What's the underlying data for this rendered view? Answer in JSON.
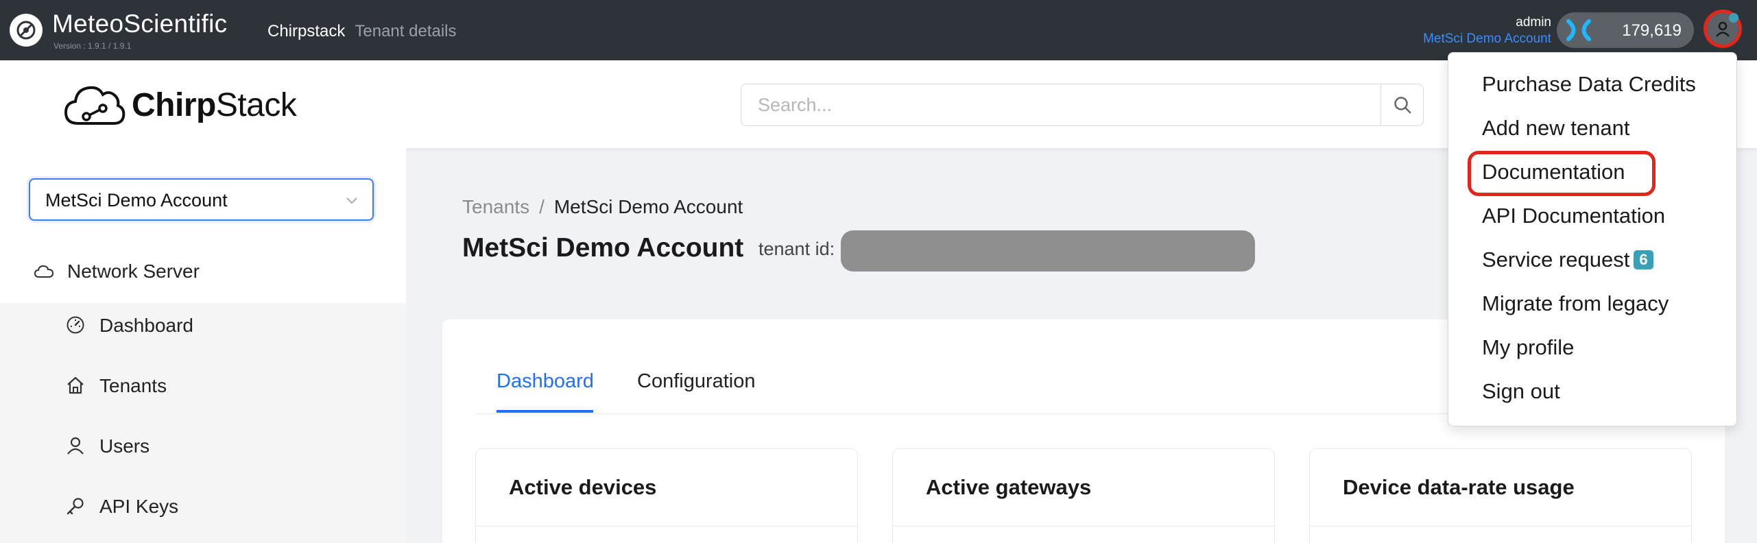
{
  "topbar": {
    "brand": "MeteoScientific",
    "version": "Version : 1.9.1 / 1.9.1",
    "crumbs": [
      "Chirpstack",
      "Tenant details"
    ],
    "user": "admin",
    "account": "MetSci Demo Account",
    "credits": "179,619"
  },
  "header": {
    "logo_text_bold": "Chirp",
    "logo_text_rest": "Stack",
    "search_placeholder": "Search..."
  },
  "sidebar": {
    "tenant": "MetSci Demo Account",
    "network_server": "Network Server",
    "items": [
      {
        "label": "Dashboard",
        "icon": "dashboard-icon"
      },
      {
        "label": "Tenants",
        "icon": "home-icon"
      },
      {
        "label": "Users",
        "icon": "user-icon"
      },
      {
        "label": "API Keys",
        "icon": "key-icon"
      }
    ]
  },
  "main": {
    "breadcrumb": [
      "Tenants",
      "/",
      "MetSci Demo Account"
    ],
    "title": "MetSci Demo Account",
    "tenant_id_label": "tenant id:",
    "tabs": [
      "Dashboard",
      "Configuration"
    ],
    "active_tab": "Dashboard",
    "cards": [
      "Active devices",
      "Active gateways",
      "Device data-rate usage"
    ]
  },
  "dropdown": {
    "items": [
      "Purchase Data Credits",
      "Add new tenant",
      "Documentation",
      "API Documentation",
      "Service request",
      "Migrate from legacy",
      "My profile",
      "Sign out"
    ],
    "service_request_badge": "6",
    "highlighted": "Documentation"
  },
  "colors": {
    "topbar": "#2e3339",
    "accent": "#1f6fff",
    "highlight": "#e2261b",
    "badge": "#3aa0b8"
  }
}
